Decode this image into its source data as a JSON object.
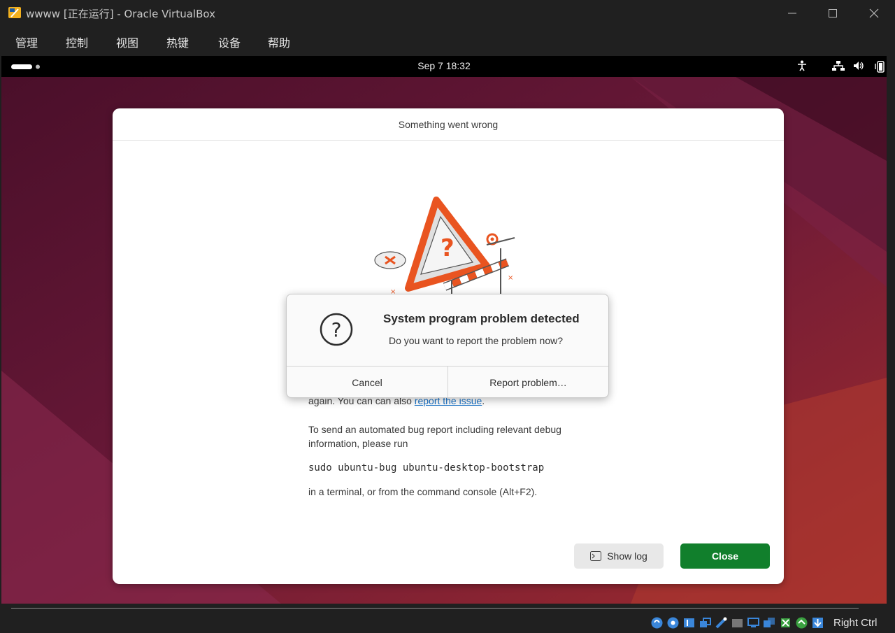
{
  "window": {
    "title": "wwww [正在运行] - Oracle VirtualBox"
  },
  "menu": {
    "items": [
      {
        "label": "管理"
      },
      {
        "label": "控制"
      },
      {
        "label": "视图"
      },
      {
        "label": "热键"
      },
      {
        "label": "设备"
      },
      {
        "label": "帮助"
      }
    ]
  },
  "guest_topbar": {
    "clock": "Sep 7  18:32",
    "tray_icons": [
      "accessibility-icon",
      "network-icon",
      "volume-icon",
      "battery-icon"
    ]
  },
  "dialog": {
    "title": "Something went wrong",
    "text_partial_prefix": "again. You can can also ",
    "link_text": "report the issue",
    "text_partial_suffix": ".",
    "para2_line1": "To send an automated bug report including relevant debug",
    "para2_line2": "information, please run",
    "command": "sudo ubuntu-bug ubuntu-desktop-bootstrap",
    "para3": "in a terminal, or from the command console (Alt+F2).",
    "show_log_label": "Show log",
    "close_label": "Close",
    "accent_color": "#117f2c"
  },
  "problem_dialog": {
    "title": "System program problem detected",
    "message": "Do you want to report the problem now?",
    "cancel_label": "Cancel",
    "report_label": "Report problem…"
  },
  "statusbar": {
    "host_key": "Right Ctrl"
  }
}
